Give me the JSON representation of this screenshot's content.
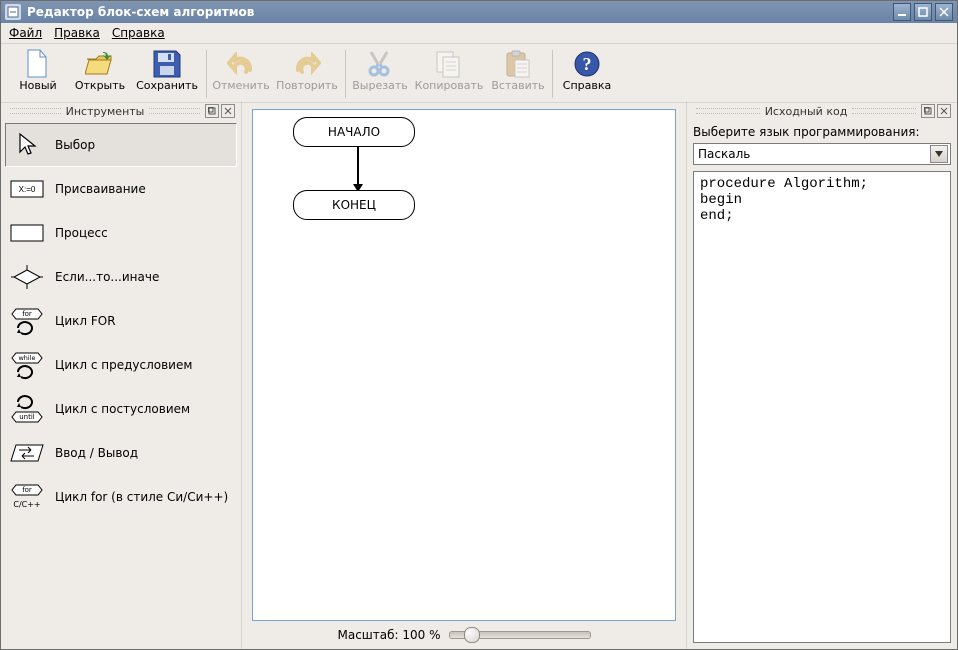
{
  "window": {
    "title": "Редактор блок-схем алгоритмов"
  },
  "menu": {
    "file": "Файл",
    "edit": "Правка",
    "help": "Справка"
  },
  "toolbar": {
    "new": "Новый",
    "open": "Открыть",
    "save": "Сохранить",
    "undo": "Отменить",
    "redo": "Повторить",
    "cut": "Вырезать",
    "copy": "Копировать",
    "paste": "Вставить",
    "help": "Справка"
  },
  "panels": {
    "tools_title": "Инструменты",
    "source_title": "Исходный код"
  },
  "tools": {
    "selection": "Выбор",
    "assign": "Присваивание",
    "process": "Процесс",
    "ifelse": "Если...то...иначе",
    "for": "Цикл FOR",
    "while": "Цикл с предусловием",
    "until": "Цикл с постусловием",
    "io": "Ввод / Вывод",
    "cfor": "Цикл for (в стиле Си/Си++)"
  },
  "flow": {
    "start": "НАЧАЛО",
    "end": "КОНЕЦ"
  },
  "zoom": {
    "label": "Масштаб: 100 %"
  },
  "source": {
    "lang_label": "Выберите язык программирования:",
    "lang_value": "Паскаль",
    "code": "procedure Algorithm;\nbegin\nend;"
  },
  "icons": {
    "while_word": "while",
    "until_word": "until",
    "for_word": "for",
    "cfor_word": "C/C++"
  }
}
